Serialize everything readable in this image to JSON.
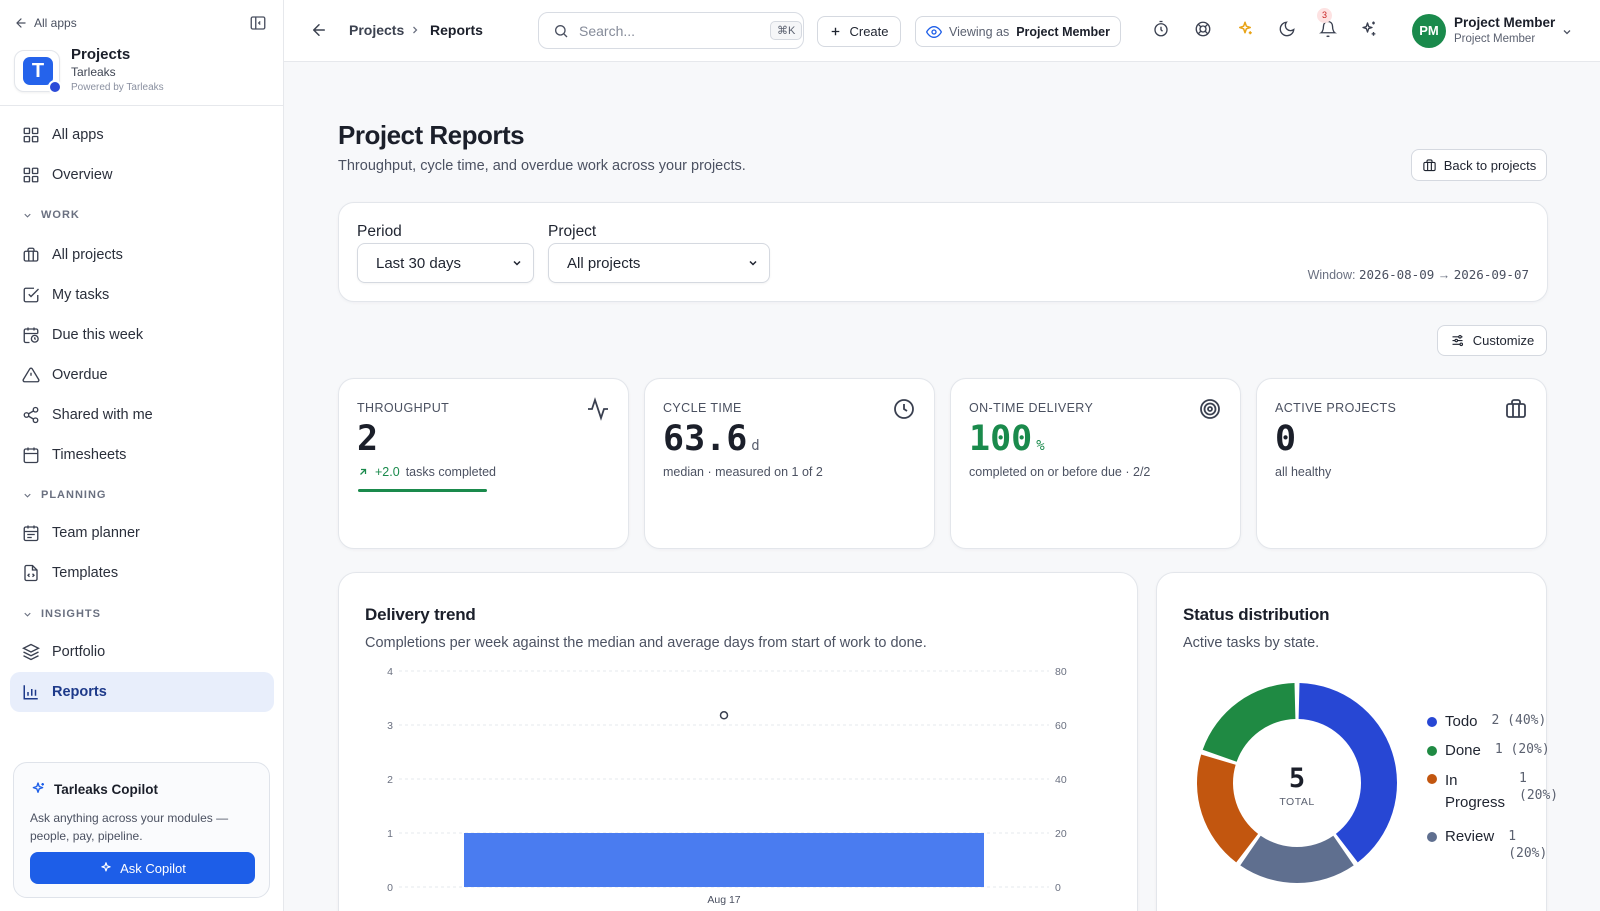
{
  "sidebar": {
    "all_apps": "All apps",
    "app_title": "Projects",
    "app_org": "Tarleaks",
    "powered_by": "Powered by Tarleaks",
    "logo_letter": "T",
    "items": [
      {
        "label": "All apps",
        "icon": "grid-icon"
      },
      {
        "label": "Overview",
        "icon": "grid-icon"
      },
      {
        "label": "All projects",
        "icon": "briefcase-icon"
      },
      {
        "label": "My tasks",
        "icon": "checkbox-icon"
      },
      {
        "label": "Due this week",
        "icon": "calendar-clock-icon"
      },
      {
        "label": "Overdue",
        "icon": "warning-icon"
      },
      {
        "label": "Shared with me",
        "icon": "share-icon"
      },
      {
        "label": "Timesheets",
        "icon": "calendar-icon"
      },
      {
        "label": "Team planner",
        "icon": "calendar-icon"
      },
      {
        "label": "Templates",
        "icon": "file-code-icon"
      },
      {
        "label": "Portfolio",
        "icon": "layers-icon"
      },
      {
        "label": "Reports",
        "icon": "bar-chart-icon",
        "active": true
      }
    ],
    "sections": [
      "WORK",
      "PLANNING",
      "INSIGHTS"
    ],
    "copilot": {
      "title": "Tarleaks Copilot",
      "description": "Ask anything across your modules — people, pay, pipeline.",
      "button": "Ask Copilot"
    }
  },
  "header": {
    "breadcrumb": [
      "Projects",
      "Reports"
    ],
    "search_placeholder": "Search...",
    "search_shortcut": "⌘K",
    "create_label": "Create",
    "viewing_prefix": "Viewing as",
    "viewing_role": "Project Member",
    "notification_count": "3",
    "user": {
      "initials": "PM",
      "name": "Project Member",
      "role": "Project Member"
    }
  },
  "page": {
    "title": "Project Reports",
    "subtitle": "Throughput, cycle time, and overdue work across your projects.",
    "back_button": "Back to projects",
    "customize_button": "Customize"
  },
  "filters": {
    "period_label": "Period",
    "period_value": "Last 30 days",
    "project_label": "Project",
    "project_value": "All projects",
    "window_label": "Window:",
    "window_start": "2026-08-09",
    "window_arrow": "→",
    "window_end": "2026-09-07"
  },
  "kpis": [
    {
      "label": "THROUGHPUT",
      "value": "2",
      "unit": "",
      "delta": "+2.0",
      "sub": "tasks completed",
      "icon": "activity-icon",
      "progress": 0.5
    },
    {
      "label": "CYCLE TIME",
      "value": "63.6",
      "unit": "d",
      "sub": "median · measured on 1 of 2",
      "icon": "clock-icon"
    },
    {
      "label": "ON-TIME DELIVERY",
      "value": "100",
      "unit": "%",
      "sub": "completed on or before due · 2/2",
      "icon": "target-icon"
    },
    {
      "label": "ACTIVE PROJECTS",
      "value": "0",
      "unit": "",
      "sub": "all healthy",
      "icon": "briefcase-icon"
    }
  ],
  "trend": {
    "title": "Delivery trend",
    "subtitle": "Completions per week against the median and average days from start of work to done."
  },
  "status": {
    "title": "Status distribution",
    "subtitle": "Active tasks by state.",
    "total": "5",
    "total_label": "TOTAL"
  },
  "colors": {
    "accent": "#1d5ee8",
    "green": "#1a8a4c",
    "bar": "#4a7cf0"
  },
  "chart_data": [
    {
      "type": "bar",
      "categories": [
        "Aug 17"
      ],
      "series": [
        {
          "values": [
            1
          ],
          "axis": "left",
          "kind": "bar"
        },
        {
          "values": [
            63.6
          ],
          "axis": "right",
          "kind": "point"
        }
      ],
      "ylim": [
        0,
        4
      ],
      "y_ticks": [
        0,
        1,
        2,
        3,
        4
      ],
      "y2lim": [
        0,
        80
      ],
      "y2_ticks": [
        0,
        20,
        40,
        60,
        80
      ],
      "grid": true
    },
    {
      "type": "pie",
      "donut": true,
      "slices": [
        {
          "label": "Todo",
          "value": 2,
          "pct": "(40%)",
          "color": "#2747d4"
        },
        {
          "label": "Review",
          "value": 1,
          "pct": "(20%)",
          "color": "#5f6f8f"
        },
        {
          "label": "In Progress",
          "value": 1,
          "pct": "(20%)",
          "color": "#c2560f"
        },
        {
          "label": "Done",
          "value": 1,
          "pct": "(20%)",
          "color": "#1f8a43"
        }
      ],
      "legend_order": [
        "Todo",
        "Done",
        "In Progress",
        "Review"
      ],
      "legend_position": "right"
    }
  ]
}
